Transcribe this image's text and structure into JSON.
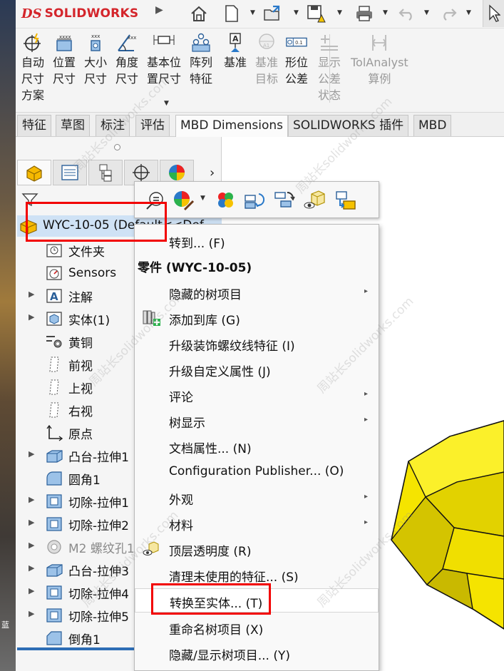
{
  "app": {
    "logo_ds": "DS",
    "logo_name": "SOLIDWORKS",
    "brand_color": "#d4252b"
  },
  "quick_access": {
    "icons": [
      "expand-arrow-icon",
      "home-icon",
      "new-document-icon",
      "open-icon",
      "save-warning-icon",
      "print-icon",
      "undo-icon",
      "redo-icon",
      "select-cursor-icon"
    ]
  },
  "ribbon": {
    "buttons": [
      {
        "label": "自动\n尺寸\n方案",
        "icon": "auto-dimension-icon",
        "enabled": true
      },
      {
        "label": "位置\n尺寸",
        "icon": "location-dimension-icon",
        "enabled": true
      },
      {
        "label": "大小\n尺寸",
        "icon": "size-dimension-icon",
        "enabled": true
      },
      {
        "label": "角度\n尺寸",
        "icon": "angle-dimension-icon",
        "enabled": true
      },
      {
        "label": "基本位\n置尺寸",
        "icon": "basic-location-dimension-icon",
        "enabled": true
      },
      {
        "label": "阵列\n特征",
        "icon": "pattern-feature-icon",
        "enabled": true
      },
      {
        "label": "基准",
        "icon": "datum-icon",
        "enabled": true
      },
      {
        "label": "基准\n目标",
        "icon": "datum-target-icon",
        "enabled": false
      },
      {
        "label": "形位\n公差",
        "icon": "geometric-tolerance-icon",
        "enabled": true
      },
      {
        "label": "显示\n公差\n状态",
        "icon": "show-tolerance-status-icon",
        "enabled": false
      },
      {
        "label": "TolAnalyst\n算例",
        "icon": "tolanalyst-icon",
        "enabled": false
      }
    ]
  },
  "tabs": [
    {
      "label": "特征",
      "active": false
    },
    {
      "label": "草图",
      "active": false
    },
    {
      "label": "标注",
      "active": false
    },
    {
      "label": "评估",
      "active": false
    },
    {
      "label": "MBD Dimensions",
      "active": true
    },
    {
      "label": "SOLIDWORKS 插件",
      "active": false
    },
    {
      "label": "MBD",
      "active": false
    }
  ],
  "feature_manager": {
    "pane_tabs": [
      "featuremanager-tree-icon",
      "propertymanager-icon",
      "configurationmanager-icon",
      "dimxpertmanager-icon",
      "displaymanager-icon"
    ],
    "more": "›",
    "root": {
      "label": "WYC-10-05 (Default<<Def"
    },
    "items": [
      {
        "label": "文件夹",
        "icon": "history-folder-icon",
        "expandable": false,
        "dim": false
      },
      {
        "label": "Sensors",
        "icon": "sensors-icon",
        "expandable": false,
        "dim": false
      },
      {
        "label": "注解",
        "icon": "annotations-icon",
        "expandable": true,
        "dim": false
      },
      {
        "label": "实体(1)",
        "icon": "solid-bodies-icon",
        "expandable": true,
        "dim": false
      },
      {
        "label": "黄铜",
        "icon": "material-icon",
        "expandable": false,
        "dim": false
      },
      {
        "label": "前视",
        "icon": "plane-icon",
        "expandable": false,
        "dim": false
      },
      {
        "label": "上视",
        "icon": "plane-icon",
        "expandable": false,
        "dim": false
      },
      {
        "label": "右视",
        "icon": "plane-icon",
        "expandable": false,
        "dim": false
      },
      {
        "label": "原点",
        "icon": "origin-icon",
        "expandable": false,
        "dim": false
      },
      {
        "label": "凸台-拉伸1",
        "icon": "boss-extrude-icon",
        "expandable": true,
        "dim": false
      },
      {
        "label": "圆角1",
        "icon": "fillet-icon",
        "expandable": false,
        "dim": false
      },
      {
        "label": "切除-拉伸1",
        "icon": "cut-extrude-icon",
        "expandable": true,
        "dim": false
      },
      {
        "label": "切除-拉伸2",
        "icon": "cut-extrude-icon",
        "expandable": true,
        "dim": false
      },
      {
        "label": "M2 螺纹孔1",
        "icon": "hole-wizard-icon",
        "expandable": true,
        "dim": true
      },
      {
        "label": "凸台-拉伸3",
        "icon": "boss-extrude-icon",
        "expandable": true,
        "dim": false
      },
      {
        "label": "切除-拉伸4",
        "icon": "cut-extrude-icon",
        "expandable": true,
        "dim": false
      },
      {
        "label": "切除-拉伸5",
        "icon": "cut-extrude-icon",
        "expandable": true,
        "dim": false
      },
      {
        "label": "倒角1",
        "icon": "chamfer-icon",
        "expandable": false,
        "dim": false
      }
    ]
  },
  "context_toolbar": {
    "icons": [
      "equations-icon",
      "appearance-icon",
      "appearance-edit-icon",
      "rebuild-icon",
      "feature-replace-icon",
      "transparency-icon",
      "convert-icon"
    ]
  },
  "context_menu": {
    "first_item": "转到... (F)",
    "header": "零件 (WYC-10-05)",
    "items": [
      {
        "label": "隐藏的树项目",
        "submenu": true,
        "icon": "",
        "highlight": false
      },
      {
        "label": "添加到库 (G)",
        "submenu": false,
        "icon": "add-to-library-icon",
        "highlight": false
      },
      {
        "label": "升级装饰螺纹线特征 (I)",
        "submenu": false,
        "icon": "",
        "highlight": false
      },
      {
        "label": "升级自定义属性 (J)",
        "submenu": false,
        "icon": "",
        "highlight": false
      },
      {
        "label": "评论",
        "submenu": true,
        "icon": "",
        "highlight": false
      },
      {
        "label": "树显示",
        "submenu": true,
        "icon": "",
        "highlight": false
      },
      {
        "label": "文档属性... (N)",
        "submenu": false,
        "icon": "",
        "highlight": false
      },
      {
        "label": "Configuration Publisher... (O)",
        "submenu": false,
        "icon": "",
        "highlight": false
      },
      {
        "label": "外观",
        "submenu": true,
        "icon": "",
        "highlight": false
      },
      {
        "label": "材料",
        "submenu": true,
        "icon": "",
        "highlight": false
      },
      {
        "label": "顶层透明度 (R)",
        "submenu": false,
        "icon": "transparency-icon",
        "highlight": false
      },
      {
        "label": "清理未使用的特征... (S)",
        "submenu": false,
        "icon": "",
        "highlight": false
      },
      {
        "label": "转换至实体... (T)",
        "submenu": false,
        "icon": "",
        "highlight": true
      },
      {
        "label": "重命名树项目 (X)",
        "submenu": false,
        "icon": "",
        "highlight": false
      },
      {
        "label": "隐藏/显示树项目... (Y)",
        "submenu": false,
        "icon": "",
        "highlight": false
      }
    ]
  },
  "watermark": "周站长solidworks.com",
  "colors": {
    "annotation_red": "#f20000",
    "part_yellow": "#f5e400",
    "tree_selection": "#cfe2f5"
  }
}
